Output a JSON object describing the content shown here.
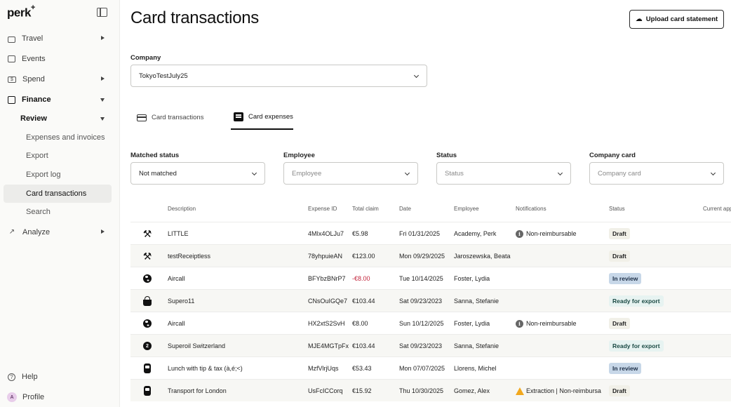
{
  "sidebar": {
    "logo": "perk",
    "logo_sup": "+",
    "items": [
      {
        "label": "Travel",
        "icon": "suitcase-icon"
      },
      {
        "label": "Events",
        "icon": "calendar-icon"
      },
      {
        "label": "Spend",
        "icon": "money-icon"
      },
      {
        "label": "Finance",
        "icon": "ledger-icon"
      },
      {
        "label": "Review"
      },
      {
        "label": "Expenses and invoices"
      },
      {
        "label": "Export"
      },
      {
        "label": "Export log"
      },
      {
        "label": "Card transactions"
      },
      {
        "label": "Search"
      },
      {
        "label": "Analyze",
        "icon": "chart-icon"
      }
    ],
    "help": "Help",
    "profile": "Profile",
    "avatar_initial": "A"
  },
  "header": {
    "title": "Card transactions",
    "upload_button": "Upload card statement"
  },
  "company": {
    "label": "Company",
    "value": "TokyoTestJuly25"
  },
  "tabs": [
    {
      "label": "Card transactions"
    },
    {
      "label": "Card expenses"
    }
  ],
  "filters": {
    "matched": {
      "label": "Matched status",
      "value": "Not matched"
    },
    "employee": {
      "label": "Employee",
      "placeholder": "Employee"
    },
    "status": {
      "label": "Status",
      "placeholder": "Status"
    },
    "card": {
      "label": "Company card",
      "placeholder": "Company card"
    }
  },
  "table": {
    "columns": [
      "Description",
      "Expense ID",
      "Total claim",
      "Date",
      "Employee",
      "Notifications",
      "Status",
      "Current app"
    ],
    "rows": [
      {
        "icon": "tools-icon",
        "description": "LITTLE",
        "id": "4MIx4OLJu7",
        "total": "€5.98",
        "date": "Fri 01/31/2025",
        "employee": "Academy, Perk",
        "notification": "Non-reimbursable",
        "notif_icon": "info",
        "status": "Draft",
        "status_kind": "draft"
      },
      {
        "icon": "tools-icon",
        "description": "testReceiptless",
        "id": "78yhpuieAN",
        "total": "€123.00",
        "date": "Mon 09/29/2025",
        "employee": "Jaroszewska, Beata",
        "notification": "",
        "notif_icon": "",
        "status": "Draft",
        "status_kind": "draft"
      },
      {
        "icon": "globe-icon",
        "description": "Aircall",
        "id": "BFYbzBNrP7",
        "total": "-€8.00",
        "date": "Tue 10/14/2025",
        "employee": "Foster, Lydia",
        "notification": "",
        "notif_icon": "",
        "status": "In review",
        "status_kind": "review"
      },
      {
        "icon": "basket-icon",
        "description": "Supero11",
        "id": "CNsOuIGQe7",
        "total": "€103.44",
        "date": "Sat 09/23/2023",
        "employee": "Sanna, Stefanie",
        "notification": "",
        "notif_icon": "",
        "status": "Ready for export",
        "status_kind": "export"
      },
      {
        "icon": "globe-icon",
        "description": "Aircall",
        "id": "HX2xtS2SvH",
        "total": "€8.00",
        "date": "Sun 10/12/2025",
        "employee": "Foster, Lydia",
        "notification": "Non-reimbursable",
        "notif_icon": "info",
        "status": "Draft",
        "status_kind": "draft"
      },
      {
        "icon": "number-icon",
        "icon_text": "2",
        "description": "Superoil Switzerland",
        "id": "MJE4MGTpFx",
        "total": "€103.44",
        "date": "Sat 09/23/2023",
        "employee": "Sanna, Stefanie",
        "notification": "",
        "notif_icon": "",
        "status": "Ready for export",
        "status_kind": "export"
      },
      {
        "icon": "train-icon",
        "description": "Lunch with tip & tax (à,é;<)",
        "id": "MzfVlrjUqs",
        "total": "€53.43",
        "date": "Mon 07/07/2025",
        "employee": "Llorens, Michel",
        "notification": "",
        "notif_icon": "",
        "status": "In review",
        "status_kind": "review"
      },
      {
        "icon": "train-icon",
        "description": "Transport for London",
        "id": "UsFcICCorq",
        "total": "€15.92",
        "date": "Thu 10/30/2025",
        "employee": "Gomez, Alex",
        "notification": "Extraction | Non-reimbursa",
        "notif_icon": "warning",
        "status": "Draft",
        "status_kind": "draft"
      }
    ]
  },
  "colors": {
    "negative": "#c2243b",
    "review_badge": "#c7d7e8",
    "export_badge": "#e7f3f1",
    "draft_badge": "#f1f0e8",
    "warning": "#f2a81d"
  }
}
